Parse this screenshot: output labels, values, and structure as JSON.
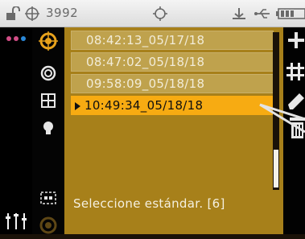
{
  "status": {
    "count": "3992"
  },
  "list": {
    "items": [
      {
        "label": "08:42:13_05/17/18"
      },
      {
        "label": "08:47:02_05/18/18"
      },
      {
        "label": "09:58:09_05/18/18"
      },
      {
        "label": "10:49:34_05/18/18"
      }
    ],
    "selected_index": 3
  },
  "footer": {
    "text": "Seleccione estándar.  [6]"
  },
  "icons": {
    "status": [
      "unlock-icon",
      "target-crosshair-icon",
      "gps-icon",
      "antenna-icon",
      "usb-icon",
      "battery-icon"
    ],
    "left": [
      "dots-menu-icon",
      "sliders-icon"
    ],
    "column": [
      "target-icon",
      "measure-icon",
      "grid-icon",
      "lightbulb-icon",
      "display-icon",
      "circle-icon"
    ],
    "right": [
      "plus-icon",
      "hash-icon",
      "pencil-icon",
      "trash-icon"
    ]
  },
  "colors": {
    "panel": "#a7801a",
    "row": "#bfa24d",
    "selected": "#f7ab12"
  },
  "scroll": {
    "position": 0.78
  }
}
